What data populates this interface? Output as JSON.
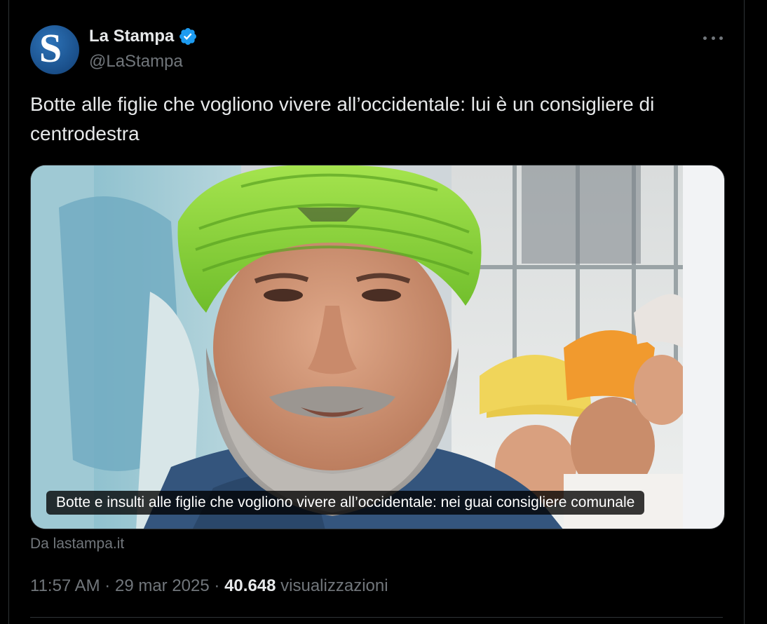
{
  "author": {
    "display_name": "La Stampa",
    "handle": "@LaStampa",
    "avatar_letter": "S",
    "verified": true,
    "verified_color": "#1d9bf0"
  },
  "tweet": {
    "text": "Botte alle figlie che vogliono vivere all’occidentale: lui è un consigliere di centrodestra"
  },
  "card": {
    "caption": "Botte e insulti alle figlie che vogliono vivere all’occidentale: nei guai consigliere comunale",
    "source": "Da lastampa.it"
  },
  "meta": {
    "time": "11:57 AM",
    "separator": "·",
    "date": "29 mar 2025",
    "views_count": "40.648",
    "views_label": "visualizzazioni"
  },
  "icons": {
    "more": "more-dots-icon",
    "verified": "verified-badge-icon"
  }
}
